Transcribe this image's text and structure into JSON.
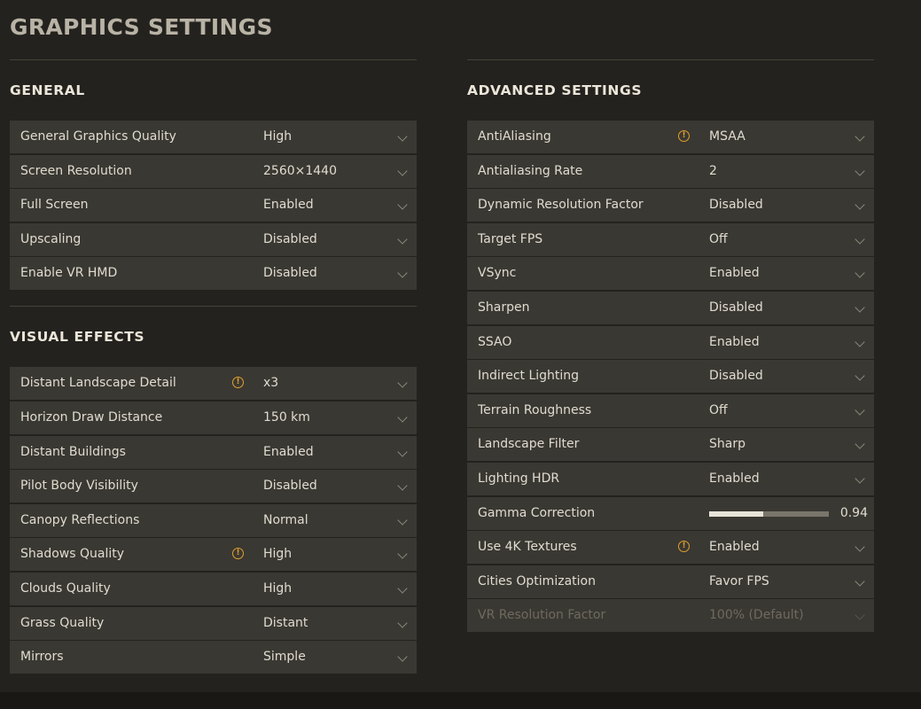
{
  "page": {
    "title": "GRAPHICS SETTINGS"
  },
  "general": {
    "title": "GENERAL",
    "rows": [
      {
        "label": "General Graphics Quality",
        "value": "High"
      },
      {
        "label": "Screen Resolution",
        "value": "2560×1440"
      },
      {
        "label": "Full Screen",
        "value": "Enabled"
      },
      {
        "label": "Upscaling",
        "value": "Disabled"
      },
      {
        "label": "Enable VR HMD",
        "value": "Disabled"
      }
    ]
  },
  "visual_effects": {
    "title": "VISUAL EFFECTS",
    "rows": [
      {
        "label": "Distant Landscape Detail",
        "value": "x3",
        "warning": "!"
      },
      {
        "label": "Horizon Draw Distance",
        "value": "150 km"
      },
      {
        "label": "Distant Buildings",
        "value": "Enabled"
      },
      {
        "label": "Pilot Body Visibility",
        "value": "Disabled"
      },
      {
        "label": "Canopy Reflections",
        "value": "Normal"
      },
      {
        "label": "Shadows Quality",
        "value": "High",
        "warning": "!"
      },
      {
        "label": "Clouds Quality",
        "value": "High"
      },
      {
        "label": "Grass Quality",
        "value": "Distant"
      },
      {
        "label": "Mirrors",
        "value": "Simple"
      }
    ]
  },
  "advanced": {
    "title": "ADVANCED SETTINGS",
    "rows": [
      {
        "label": "AntiAliasing",
        "value": "MSAA",
        "warning": "!"
      },
      {
        "label": "Antialiasing Rate",
        "value": "2"
      },
      {
        "label": "Dynamic Resolution Factor",
        "value": "Disabled"
      },
      {
        "label": "Target FPS",
        "value": "Off"
      },
      {
        "label": "VSync",
        "value": "Enabled"
      },
      {
        "label": "Sharpen",
        "value": "Disabled"
      },
      {
        "label": "SSAO",
        "value": "Enabled"
      },
      {
        "label": "Indirect Lighting",
        "value": "Disabled"
      },
      {
        "label": "Terrain Roughness",
        "value": "Off"
      },
      {
        "label": "Landscape Filter",
        "value": "Sharp"
      },
      {
        "label": "Lighting HDR",
        "value": "Enabled"
      },
      {
        "label": "Gamma Correction",
        "value": "0.94",
        "slider_fraction": 0.45
      },
      {
        "label": "Use 4K Textures",
        "value": "Enabled",
        "warning": "!"
      },
      {
        "label": "Cities Optimization",
        "value": "Favor FPS"
      },
      {
        "label": "VR Resolution Factor",
        "value": "100% (Default)",
        "disabled": true
      }
    ]
  },
  "colors": {
    "background": "#24221e",
    "row": "#3a3832",
    "warning": "#e0a030",
    "text": "#e0dbd0",
    "disabled_text": "#6f6a60"
  }
}
